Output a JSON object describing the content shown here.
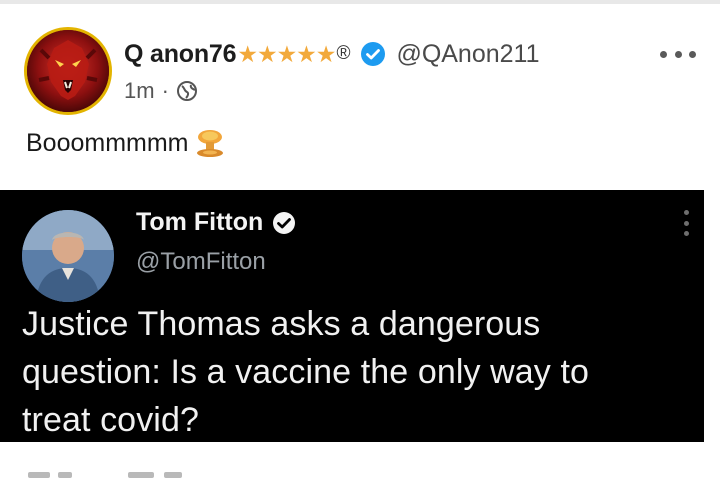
{
  "post": {
    "author_name": "Q anon76",
    "stars": "★★★★★",
    "registered_mark": "®",
    "handle": "@QAnon211",
    "time": "1m",
    "separator": "·",
    "icons": {
      "avatar": "lion-avatar",
      "verified": "verified-badge-icon",
      "audience": "globe-icon",
      "more": "more-options-icon"
    },
    "text": "Booommmmm",
    "emoji": "mushroom-cloud-icon"
  },
  "embedded_tweet": {
    "author_name": "Tom Fitton",
    "handle": "@TomFitton",
    "lines": [
      "Justice Thomas asks a dangerous",
      "question: Is a vaccine the only way to",
      "treat covid?"
    ],
    "icons": {
      "avatar": "person-avatar",
      "verified": "verified-badge-icon",
      "more": "vertical-more-icon"
    }
  },
  "colors": {
    "star": "#f2a93b",
    "verified_blue": "#1d9bf0",
    "avatar_ring": "#e3b400",
    "embed_bg": "#000000"
  }
}
